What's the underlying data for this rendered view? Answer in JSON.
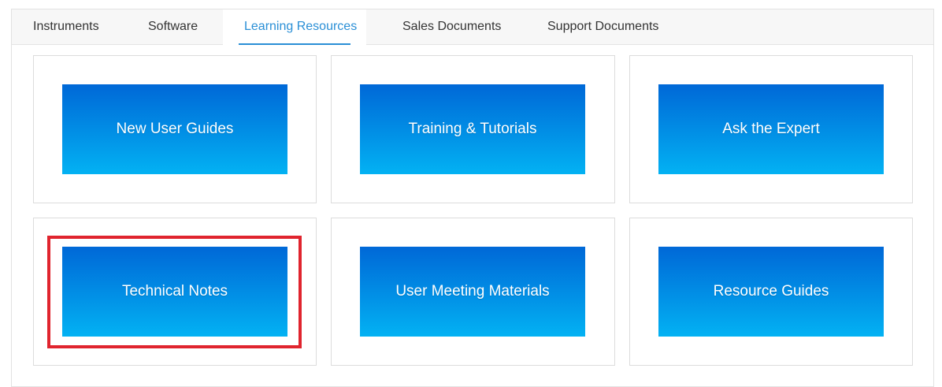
{
  "tabs": {
    "instruments": "Instruments",
    "software": "Software",
    "learning_resources": "Learning Resources",
    "sales_documents": "Sales Documents",
    "support_documents": "Support Documents",
    "active": "Learning Resources"
  },
  "tiles": {
    "new_user_guides": "New User Guides",
    "training_tutorials": "Training & Tutorials",
    "ask_the_expert": "Ask the Expert",
    "technical_notes": "Technical Notes",
    "user_meeting_materials": "User Meeting Materials",
    "resource_guides": "Resource Guides"
  },
  "colors": {
    "accent": "#2a8fd6",
    "tile_gradient_top": "#0068d7",
    "tile_gradient_bottom": "#03b2f3",
    "highlight": "#e0242e"
  }
}
